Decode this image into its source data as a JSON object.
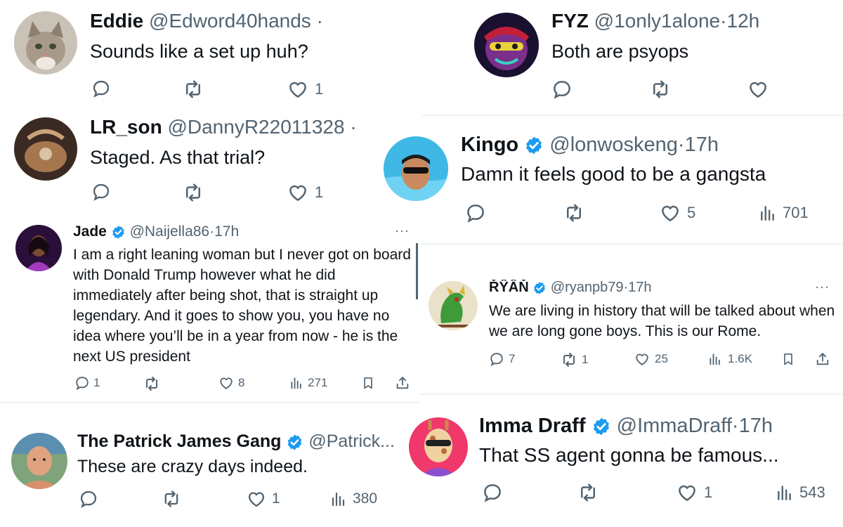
{
  "tweets": [
    {
      "name": "Eddie",
      "handle": "@Edword40hands",
      "dot": "·",
      "text": "Sounds like a set up huh?",
      "likes": "1",
      "avatar": "cat-avatar"
    },
    {
      "name": "FYZ",
      "handle": "@1only1alone",
      "dot": "·",
      "time": "12h",
      "text": "Both are psyops",
      "avatar": "art-avatar"
    },
    {
      "name": "LR_son",
      "handle": "@DannyR22011328",
      "dot": "·",
      "text": "Staged. As that trial?",
      "likes": "1",
      "avatar": "hands-avatar"
    },
    {
      "name": "Kingo",
      "handle": "@lonwoskeng",
      "dot": "·",
      "time": "17h",
      "text": "Damn it feels good to be a gangsta",
      "likes": "5",
      "views": "701",
      "avatar": "pool-avatar"
    },
    {
      "name": "Jade",
      "handle": "@Naijella86",
      "dot": "·",
      "time": "17h",
      "text": "I am a right leaning woman but I never got on board with Donald Trump however  what he did immediately after being shot, that is straight up legendary. And it goes to show you, you have no idea where you’ll be in a year from now - he is the next US president",
      "replies": "1",
      "likes": "8",
      "views": "271",
      "more": "···",
      "avatar": "woman-avatar"
    },
    {
      "name": "ŘŶÂŇ",
      "handle": "@ryanpb79",
      "dot": "·",
      "time": "17h",
      "text": "We are living in history that will be talked about when we are long gone boys.  This is our Rome.",
      "replies": "7",
      "reposts": "1",
      "likes": "25",
      "views": "1.6K",
      "more": "···",
      "avatar": "dragon-avatar"
    },
    {
      "name": "The Patrick James Gang",
      "handle": "@Patrick...",
      "text": "These are crazy days indeed.",
      "likes": "1",
      "views": "380",
      "avatar": "man-avatar"
    },
    {
      "name": "Imma Draff",
      "handle": "@ImmaDraff",
      "dot": "·",
      "time": "17h",
      "text": "That SS agent gonna be famous...",
      "likes": "1",
      "views": "543",
      "avatar": "giraffe-avatar"
    }
  ],
  "colors": {
    "text": "#0f1419",
    "secondary": "#536471",
    "verified": "#1d9bf0",
    "divider": "#eff3f4"
  }
}
